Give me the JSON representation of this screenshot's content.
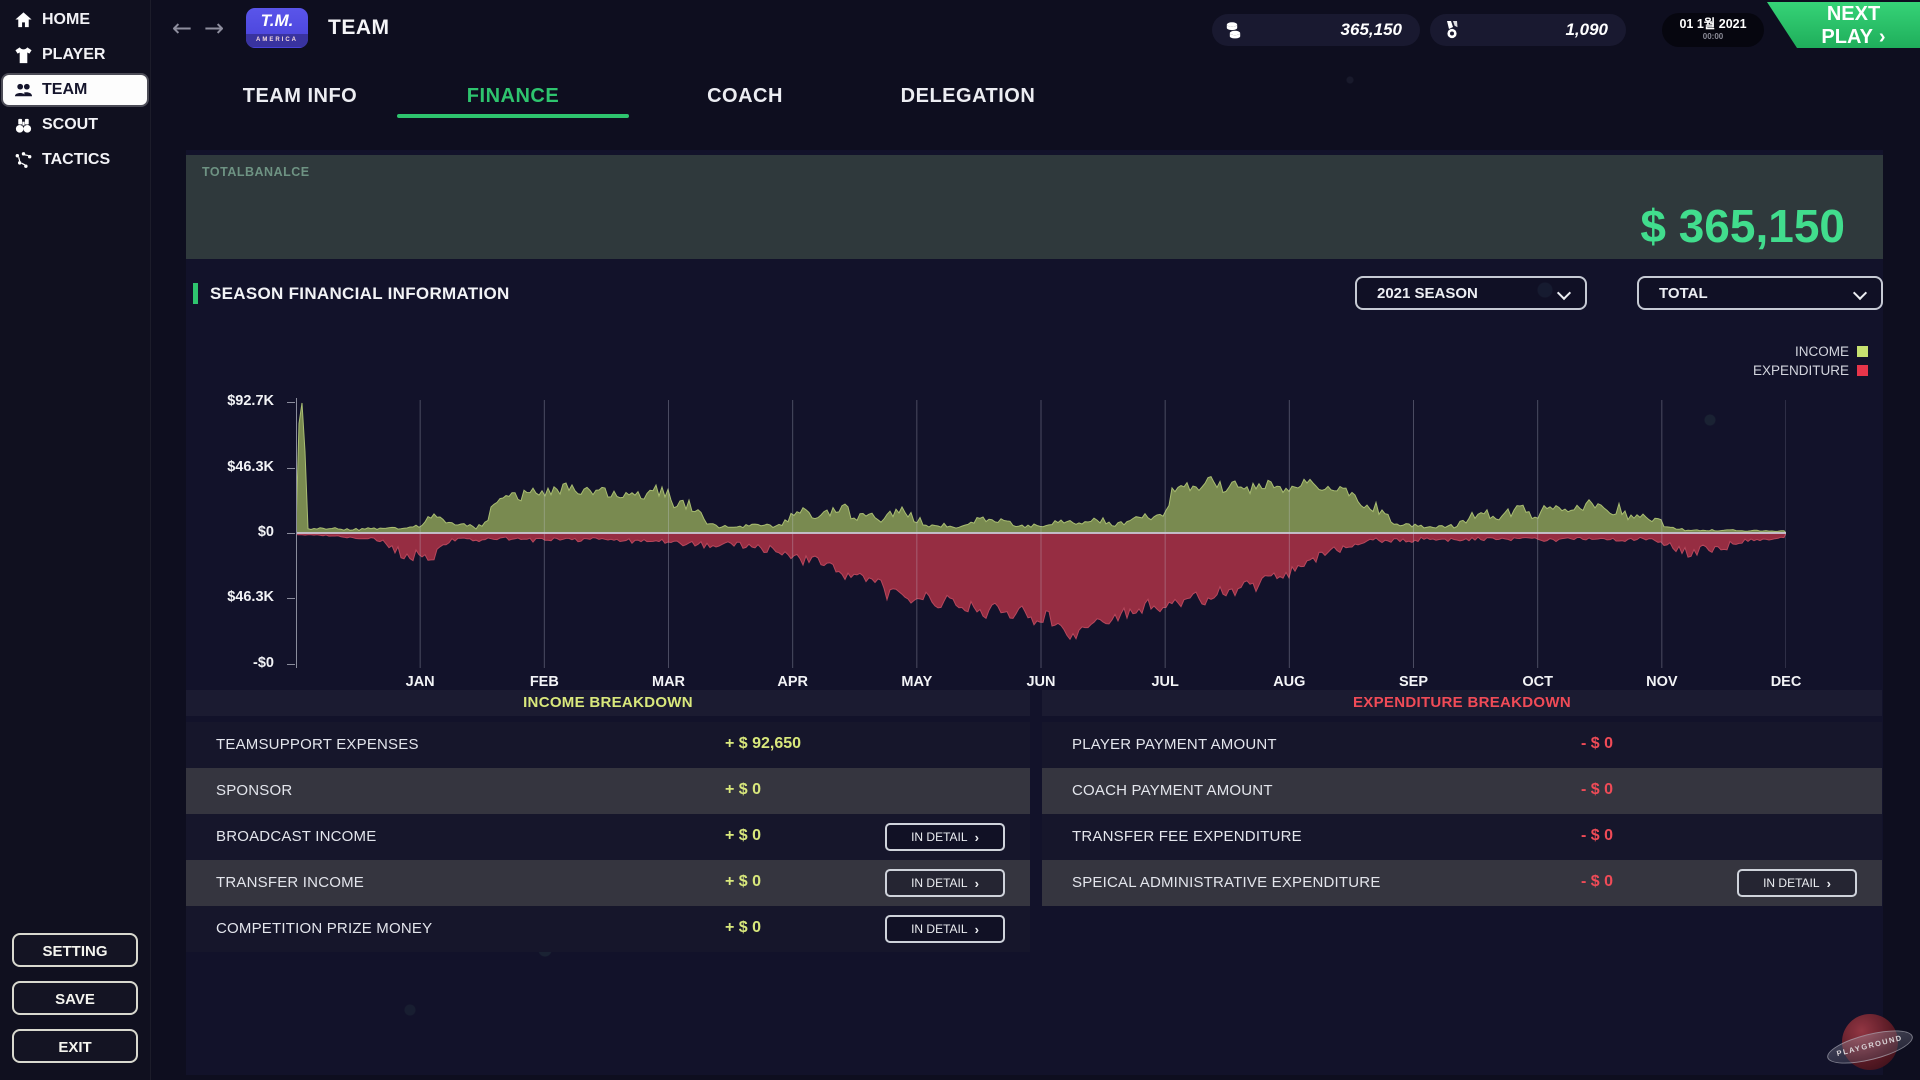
{
  "ui": {
    "title": "TEAM",
    "back_arrow": "←",
    "forward_arrow": "→",
    "logo": {
      "line1": "T.M.",
      "line2": "AMERICA"
    },
    "money": "365,150",
    "medals": "1,090",
    "date": "01 1월 2021",
    "time": "00:00",
    "next_play": "NEXT PLAY",
    "next_play_chevron": "›",
    "in_detail": "IN DETAIL",
    "detail_chevron": "›"
  },
  "colors": {
    "accent": "#2ec46e",
    "balance": "#41dd8d",
    "income": "#d9e87c",
    "expenditure": "#f04b57"
  },
  "sidebar": {
    "items": [
      {
        "label": "HOME"
      },
      {
        "label": "PLAYER"
      },
      {
        "label": "TEAM",
        "active": true
      },
      {
        "label": "SCOUT"
      },
      {
        "label": "TACTICS"
      }
    ],
    "footer": [
      {
        "label": "SETTING"
      },
      {
        "label": "SAVE"
      },
      {
        "label": "EXIT"
      }
    ]
  },
  "tabs": [
    {
      "label": "TEAM INFO"
    },
    {
      "label": "FINANCE",
      "active": true
    },
    {
      "label": "COACH"
    },
    {
      "label": "DELEGATION"
    }
  ],
  "balance": {
    "label": "TOTALBANALCE",
    "value": "$ 365,150"
  },
  "season": {
    "title": "SEASON FINANCIAL INFORMATION",
    "season_dropdown": "2021 SEASON",
    "scope_dropdown": "TOTAL"
  },
  "chart_data": {
    "type": "area",
    "title": "SEASON FINANCIAL INFORMATION",
    "unit": "USD thousands",
    "x_labels": [
      "JAN",
      "FEB",
      "MAR",
      "APR",
      "MAY",
      "JUN",
      "JUL",
      "AUG",
      "SEP",
      "OCT",
      "NOV",
      "DEC"
    ],
    "y_tick_labels": [
      "$92.7K",
      "$46.3K",
      "$0",
      "$46.3K",
      "-$0"
    ],
    "y_tick_values": [
      92.7,
      46.3,
      0,
      -46.3,
      -92.7
    ],
    "ylim": [
      -92.7,
      92.7
    ],
    "grid": "vertical-monthly",
    "legend_position": "top-right",
    "legend": [
      {
        "label": "INCOME",
        "color": "#c7e170"
      },
      {
        "label": "EXPENDITURE",
        "color": "#e8354a"
      }
    ],
    "series": [
      {
        "name": "INCOME",
        "fill": "#7e9052",
        "stroke": "#a9bd72",
        "points": [
          [
            0,
            2
          ],
          [
            0.03,
            92.7
          ],
          [
            0.06,
            92.7
          ],
          [
            0.09,
            3
          ],
          [
            0.3,
            3
          ],
          [
            0.5,
            2.5
          ],
          [
            0.7,
            4
          ],
          [
            0.85,
            3
          ],
          [
            1.0,
            5
          ],
          [
            1.1,
            13
          ],
          [
            1.2,
            8
          ],
          [
            1.3,
            6
          ],
          [
            1.45,
            4
          ],
          [
            1.55,
            10
          ],
          [
            1.6,
            24
          ],
          [
            1.7,
            30
          ],
          [
            1.8,
            26
          ],
          [
            1.9,
            32
          ],
          [
            2.0,
            28
          ],
          [
            2.1,
            30
          ],
          [
            2.2,
            33
          ],
          [
            2.3,
            27
          ],
          [
            2.4,
            31
          ],
          [
            2.5,
            28
          ],
          [
            2.6,
            25
          ],
          [
            2.7,
            29
          ],
          [
            2.8,
            26
          ],
          [
            2.9,
            30
          ],
          [
            3.0,
            27
          ],
          [
            3.05,
            18
          ],
          [
            3.15,
            21
          ],
          [
            3.25,
            16
          ],
          [
            3.3,
            6
          ],
          [
            3.5,
            4
          ],
          [
            3.7,
            5
          ],
          [
            3.9,
            5
          ],
          [
            4.0,
            12
          ],
          [
            4.1,
            16
          ],
          [
            4.2,
            10
          ],
          [
            4.3,
            14
          ],
          [
            4.4,
            18
          ],
          [
            4.5,
            12
          ],
          [
            4.6,
            15
          ],
          [
            4.7,
            9
          ],
          [
            4.8,
            13
          ],
          [
            4.9,
            16
          ],
          [
            5.0,
            10
          ],
          [
            5.1,
            4
          ],
          [
            5.2,
            6
          ],
          [
            5.3,
            3
          ],
          [
            5.4,
            6
          ],
          [
            5.5,
            12
          ],
          [
            5.6,
            8
          ],
          [
            5.7,
            10
          ],
          [
            5.8,
            6
          ],
          [
            5.9,
            5
          ],
          [
            6.0,
            6
          ],
          [
            6.2,
            8
          ],
          [
            6.35,
            7
          ],
          [
            6.5,
            10
          ],
          [
            6.6,
            6
          ],
          [
            6.75,
            9
          ],
          [
            6.9,
            12
          ],
          [
            7.0,
            10
          ],
          [
            7.05,
            28
          ],
          [
            7.15,
            34
          ],
          [
            7.25,
            30
          ],
          [
            7.35,
            38
          ],
          [
            7.45,
            32
          ],
          [
            7.55,
            35
          ],
          [
            7.65,
            29
          ],
          [
            7.75,
            33
          ],
          [
            7.85,
            36
          ],
          [
            7.95,
            31
          ],
          [
            8.05,
            34
          ],
          [
            8.15,
            38
          ],
          [
            8.25,
            30
          ],
          [
            8.35,
            33
          ],
          [
            8.45,
            28
          ],
          [
            8.55,
            25
          ],
          [
            8.6,
            15
          ],
          [
            8.7,
            18
          ],
          [
            8.8,
            10
          ],
          [
            8.9,
            6
          ],
          [
            9.0,
            5
          ],
          [
            9.2,
            4
          ],
          [
            9.35,
            5
          ],
          [
            9.45,
            12
          ],
          [
            9.55,
            16
          ],
          [
            9.65,
            10
          ],
          [
            9.75,
            14
          ],
          [
            9.85,
            18
          ],
          [
            9.95,
            12
          ],
          [
            10.05,
            16
          ],
          [
            10.15,
            20
          ],
          [
            10.25,
            13
          ],
          [
            10.35,
            17
          ],
          [
            10.45,
            21
          ],
          [
            10.55,
            14
          ],
          [
            10.65,
            18
          ],
          [
            10.75,
            12
          ],
          [
            10.85,
            15
          ],
          [
            10.95,
            10
          ],
          [
            11.05,
            4
          ],
          [
            11.2,
            2
          ],
          [
            11.5,
            2
          ],
          [
            11.8,
            1.5
          ],
          [
            12,
            1.5
          ]
        ]
      },
      {
        "name": "EXPENDITURE",
        "fill": "#9c2f44",
        "stroke": "#b8475c",
        "points": [
          [
            0,
            -1
          ],
          [
            0.3,
            -2
          ],
          [
            0.5,
            -4
          ],
          [
            0.6,
            -3
          ],
          [
            0.7,
            -6
          ],
          [
            0.8,
            -12
          ],
          [
            0.9,
            -18
          ],
          [
            1.0,
            -14
          ],
          [
            1.1,
            -16
          ],
          [
            1.2,
            -8
          ],
          [
            1.3,
            -4
          ],
          [
            1.5,
            -5
          ],
          [
            1.7,
            -4
          ],
          [
            1.9,
            -5
          ],
          [
            2.1,
            -4
          ],
          [
            2.3,
            -5
          ],
          [
            2.5,
            -4
          ],
          [
            2.7,
            -6
          ],
          [
            2.9,
            -5
          ],
          [
            3.1,
            -7
          ],
          [
            3.3,
            -9
          ],
          [
            3.5,
            -7
          ],
          [
            3.7,
            -10
          ],
          [
            3.9,
            -12
          ],
          [
            4.0,
            -15
          ],
          [
            4.1,
            -20
          ],
          [
            4.2,
            -18
          ],
          [
            4.3,
            -25
          ],
          [
            4.4,
            -30
          ],
          [
            4.5,
            -28
          ],
          [
            4.6,
            -35
          ],
          [
            4.7,
            -32
          ],
          [
            4.75,
            -45
          ],
          [
            4.85,
            -40
          ],
          [
            4.95,
            -48
          ],
          [
            5.05,
            -44
          ],
          [
            5.15,
            -52
          ],
          [
            5.25,
            -46
          ],
          [
            5.35,
            -55
          ],
          [
            5.45,
            -50
          ],
          [
            5.55,
            -58
          ],
          [
            5.65,
            -52
          ],
          [
            5.75,
            -60
          ],
          [
            5.85,
            -55
          ],
          [
            5.95,
            -62
          ],
          [
            6.05,
            -58
          ],
          [
            6.15,
            -68
          ],
          [
            6.25,
            -74
          ],
          [
            6.35,
            -65
          ],
          [
            6.45,
            -60
          ],
          [
            6.55,
            -66
          ],
          [
            6.65,
            -56
          ],
          [
            6.75,
            -58
          ],
          [
            6.85,
            -50
          ],
          [
            6.95,
            -55
          ],
          [
            7.05,
            -52
          ],
          [
            7.15,
            -48
          ],
          [
            7.25,
            -45
          ],
          [
            7.35,
            -48
          ],
          [
            7.45,
            -40
          ],
          [
            7.55,
            -43
          ],
          [
            7.65,
            -35
          ],
          [
            7.75,
            -38
          ],
          [
            7.85,
            -30
          ],
          [
            7.95,
            -33
          ],
          [
            8.05,
            -25
          ],
          [
            8.15,
            -20
          ],
          [
            8.25,
            -15
          ],
          [
            8.35,
            -10
          ],
          [
            8.45,
            -12
          ],
          [
            8.55,
            -8
          ],
          [
            8.7,
            -5
          ],
          [
            8.9,
            -6
          ],
          [
            9.1,
            -4
          ],
          [
            9.3,
            -5
          ],
          [
            9.5,
            -4
          ],
          [
            9.7,
            -5
          ],
          [
            9.9,
            -4
          ],
          [
            10.1,
            -5
          ],
          [
            10.3,
            -4
          ],
          [
            10.5,
            -4
          ],
          [
            10.7,
            -5
          ],
          [
            10.9,
            -4
          ],
          [
            11.05,
            -8
          ],
          [
            11.15,
            -12
          ],
          [
            11.25,
            -15
          ],
          [
            11.35,
            -11
          ],
          [
            11.45,
            -13
          ],
          [
            11.55,
            -8
          ],
          [
            11.7,
            -5
          ],
          [
            11.85,
            -4
          ],
          [
            12,
            -3
          ]
        ]
      }
    ]
  },
  "income_table": {
    "title": "INCOME BREAKDOWN",
    "rows": [
      {
        "label": "TEAMSUPPORT EXPENSES",
        "value": "+ $ 92,650",
        "detail": false
      },
      {
        "label": "SPONSOR",
        "value": "+ $ 0",
        "detail": false
      },
      {
        "label": "BROADCAST INCOME",
        "value": "+ $ 0",
        "detail": true
      },
      {
        "label": "TRANSFER INCOME",
        "value": "+ $ 0",
        "detail": true
      },
      {
        "label": "COMPETITION PRIZE MONEY",
        "value": "+ $ 0",
        "detail": true
      }
    ]
  },
  "expenditure_table": {
    "title": "EXPENDITURE BREAKDOWN",
    "rows": [
      {
        "label": "PLAYER PAYMENT AMOUNT",
        "value": "- $ 0",
        "detail": false
      },
      {
        "label": "COACH PAYMENT AMOUNT",
        "value": "- $ 0",
        "detail": false
      },
      {
        "label": "TRANSFER FEE EXPENDITURE",
        "value": "- $ 0",
        "detail": false
      },
      {
        "label": "SPEICAL ADMINISTRATIVE EXPENDITURE",
        "value": "- $ 0",
        "detail": true
      }
    ]
  },
  "watermark": "PLAYGROUND"
}
